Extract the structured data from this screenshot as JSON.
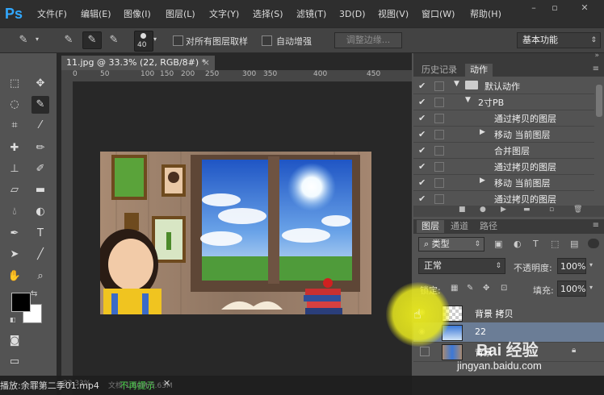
{
  "app": {
    "logo": "Ps",
    "menu": [
      "文件(F)",
      "编辑(E)",
      "图像(I)",
      "图层(L)",
      "文字(Y)",
      "选择(S)",
      "滤镜(T)",
      "3D(D)",
      "视图(V)",
      "窗口(W)",
      "帮助(H)"
    ],
    "window_controls": [
      "–",
      "▫",
      "✕"
    ]
  },
  "options_bar": {
    "brush_size": "40",
    "sample_all_layers": "对所有图层取样",
    "auto_enhance": "自动增强",
    "refine_edge": "调整边缘...",
    "workspace": "基本功能"
  },
  "document": {
    "tab_title": "11.jpg @ 33.3% (22, RGB/8#) *",
    "tab_close": "×",
    "ruler_ticks": [
      "0",
      "50",
      "100",
      "150",
      "200",
      "250",
      "300",
      "350",
      "400",
      "450"
    ]
  },
  "actions_panel": {
    "tabs": [
      "历史记录",
      "动作"
    ],
    "active_tab": "动作",
    "rows": [
      {
        "label": "默认动作",
        "level": 0,
        "expanded": true,
        "folder": true
      },
      {
        "label": "2寸PB",
        "level": 1,
        "expanded": true,
        "folder": false
      },
      {
        "label": "通过拷贝的图层",
        "level": 2,
        "expanded": false,
        "folder": false
      },
      {
        "label": "移动 当前图层",
        "level": 2,
        "expanded": false,
        "folder": false,
        "has_arrow": true
      },
      {
        "label": "合并图层",
        "level": 2,
        "expanded": false,
        "folder": false
      },
      {
        "label": "通过拷贝的图层",
        "level": 2,
        "expanded": false,
        "folder": false
      },
      {
        "label": "移动 当前图层",
        "level": 2,
        "expanded": false,
        "folder": false,
        "has_arrow": true
      },
      {
        "label": "通过拷贝的图层",
        "level": 2,
        "expanded": false,
        "folder": false
      }
    ]
  },
  "layers_panel": {
    "tabs": [
      "图层",
      "通道",
      "路径"
    ],
    "active_tab": "图层",
    "filter_kind": "类型",
    "blend_mode": "正常",
    "opacity_label": "不透明度:",
    "opacity": "100%",
    "lock_label": "锁定:",
    "fill_label": "填充:",
    "fill": "100%",
    "layers": [
      {
        "name": "背景 拷贝",
        "visible": true,
        "selected": false
      },
      {
        "name": "22",
        "visible": true,
        "selected": true
      },
      {
        "name": "背景",
        "visible": false,
        "selected": false,
        "locked": true
      }
    ]
  },
  "statusbar": {
    "notification": "播放:余罪第二季01.mp4",
    "dismiss": "不再提示",
    "close": "✕",
    "zoom": "33.33%",
    "doc_size": "文档:1.80M/5.63M"
  },
  "watermark": {
    "brand": "Bai 经验",
    "url": "jingyan.baidu.com"
  },
  "colors": {
    "accent_blue": "#31a8ff",
    "selection_blue": "#6b7d96",
    "highlight_yellow": "#ebeb1e"
  }
}
